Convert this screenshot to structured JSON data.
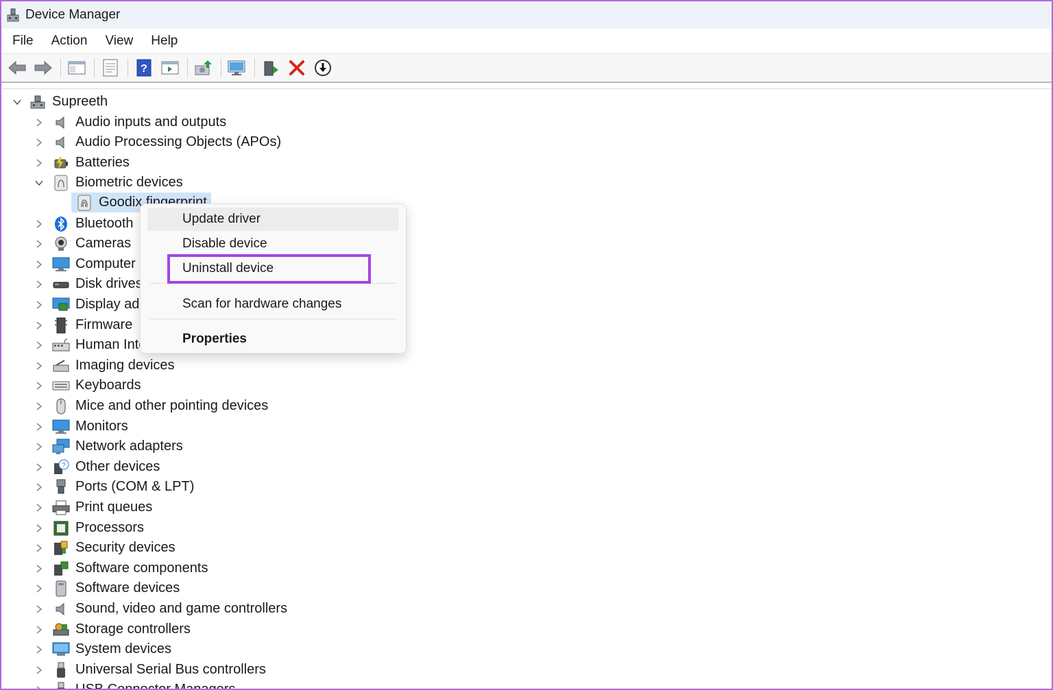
{
  "window": {
    "title": "Device Manager"
  },
  "menubar": {
    "items": [
      "File",
      "Action",
      "View",
      "Help"
    ]
  },
  "toolbar": {
    "buttons": [
      "back-arrow-icon",
      "forward-arrow-icon",
      "show-hide-console-tree-icon",
      "properties-icon",
      "help-icon",
      "action-pane-icon",
      "update-driver-icon",
      "scan-hardware-icon",
      "enable-device-icon",
      "uninstall-device-icon",
      "disable-device-icon"
    ]
  },
  "tree": {
    "root": "Supreeth",
    "categories": [
      "Audio inputs and outputs",
      "Audio Processing Objects (APOs)",
      "Batteries",
      "Biometric devices",
      "Bluetooth",
      "Cameras",
      "Computer",
      "Disk drives",
      "Display ada",
      "Firmware",
      "Human Inte",
      "Imaging devices",
      "Keyboards",
      "Mice and other pointing devices",
      "Monitors",
      "Network adapters",
      "Other devices",
      "Ports (COM & LPT)",
      "Print queues",
      "Processors",
      "Security devices",
      "Software components",
      "Software devices",
      "Sound, video and game controllers",
      "Storage controllers",
      "System devices",
      "Universal Serial Bus controllers",
      "USB Connector Managers"
    ],
    "selected_child": "Goodix fingerprint"
  },
  "context_menu": {
    "update_driver": "Update driver",
    "disable_device": "Disable device",
    "uninstall_device": "Uninstall device",
    "scan_hardware": "Scan for hardware changes",
    "properties": "Properties"
  },
  "colors": {
    "highlight": "#a247e0",
    "frame": "#b06ad9",
    "selection": "#cfe4f7"
  }
}
